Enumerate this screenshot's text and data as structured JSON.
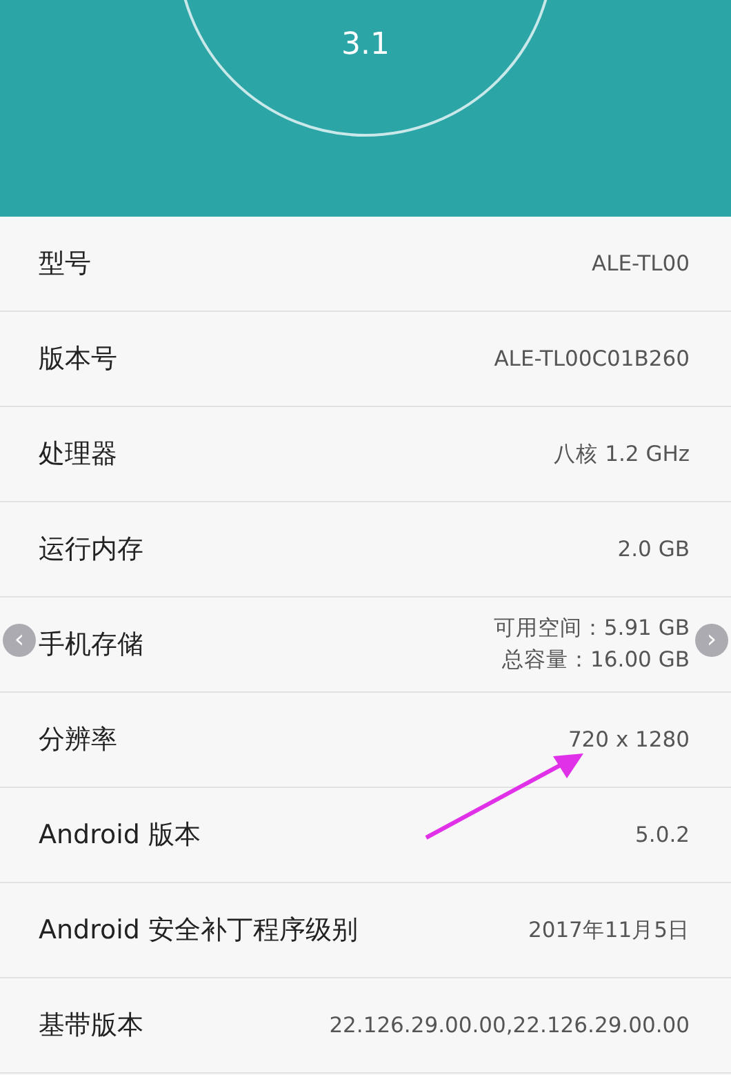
{
  "header": {
    "version": "3.1"
  },
  "rows": [
    {
      "label": "型号",
      "values": [
        "ALE-TL00"
      ]
    },
    {
      "label": "版本号",
      "values": [
        "ALE-TL00C01B260"
      ]
    },
    {
      "label": "处理器",
      "values": [
        "八核 1.2 GHz"
      ]
    },
    {
      "label": "运行内存",
      "values": [
        "2.0 GB"
      ]
    },
    {
      "label": "手机存储",
      "values": [
        "可用空间：5.91 GB",
        "总容量：16.00 GB"
      ]
    },
    {
      "label": "分辨率",
      "values": [
        "720 x 1280"
      ]
    },
    {
      "label": "Android 版本",
      "values": [
        "5.0.2"
      ]
    },
    {
      "label": "Android 安全补丁程序级别",
      "values": [
        "2017年11月5日"
      ]
    },
    {
      "label": "基带版本",
      "values": [
        "22.126.29.00.00,22.126.29.00.00"
      ]
    }
  ],
  "viewer": {
    "prev_arrow": "‹",
    "next_arrow": "›"
  }
}
